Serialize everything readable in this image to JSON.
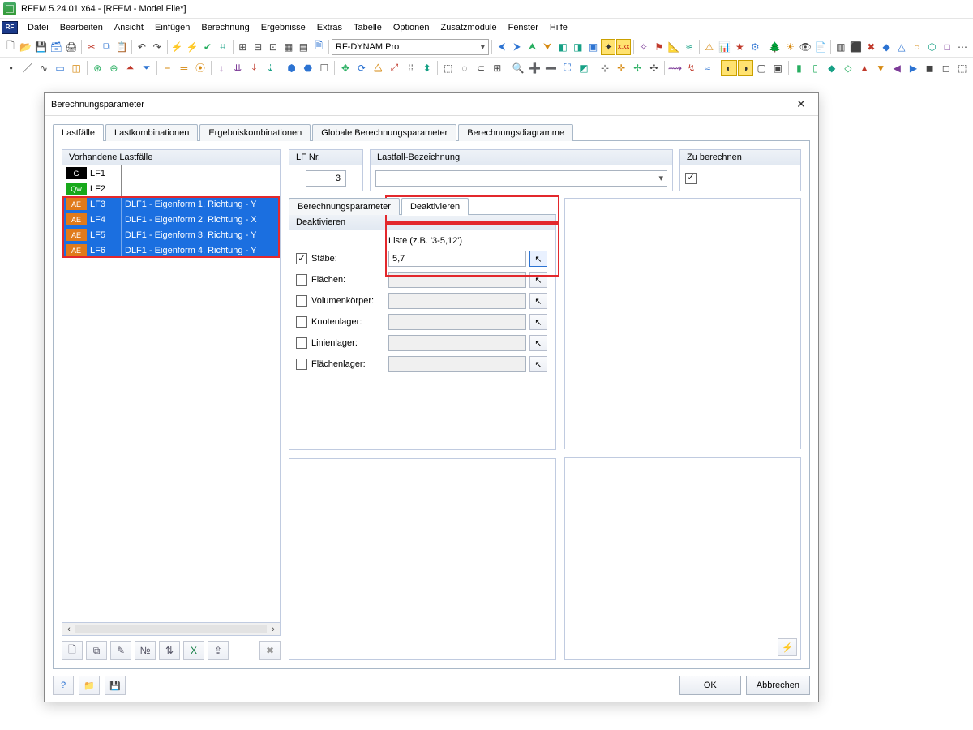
{
  "title": "RFEM 5.24.01 x64 - [RFEM - Model File*]",
  "mdi_icon": "RF",
  "menu": [
    "Datei",
    "Bearbeiten",
    "Ansicht",
    "Einfügen",
    "Berechnung",
    "Ergebnisse",
    "Extras",
    "Tabelle",
    "Optionen",
    "Zusatzmodule",
    "Fenster",
    "Hilfe"
  ],
  "toolbar_combo": "RF-DYNAM Pro",
  "dialog": {
    "title": "Berechnungsparameter",
    "tabs": [
      "Lastfälle",
      "Lastkombinationen",
      "Ergebniskombinationen",
      "Globale Berechnungsparameter",
      "Berechnungsdiagramme"
    ],
    "active_tab": 0,
    "left": {
      "caption": "Vorhandene Lastfälle",
      "rows": [
        {
          "tag": "G",
          "code": "LF1",
          "desc": "",
          "sel": false
        },
        {
          "tag": "Qw",
          "code": "LF2",
          "desc": "",
          "sel": false
        },
        {
          "tag": "AE",
          "code": "LF3",
          "desc": "DLF1 - Eigenform 1, Richtung - Y",
          "sel": true
        },
        {
          "tag": "AE",
          "code": "LF4",
          "desc": "DLF1 - Eigenform 2, Richtung - X",
          "sel": true
        },
        {
          "tag": "AE",
          "code": "LF5",
          "desc": "DLF1 - Eigenform 3, Richtung - Y",
          "sel": true
        },
        {
          "tag": "AE",
          "code": "LF6",
          "desc": "DLF1 - Eigenform 4, Richtung - Y",
          "sel": true
        }
      ]
    },
    "right": {
      "lfnr_caption": "LF Nr.",
      "lfnr_value": "3",
      "bez_caption": "Lastfall-Bezeichnung",
      "bez_value": "",
      "calc_caption": "Zu berechnen",
      "calc_checked": true,
      "sub_tabs": [
        "Berechnungsparameter",
        "Deaktivieren"
      ],
      "sub_active": 1,
      "deakt": {
        "caption": "Deaktivieren",
        "list_hdr": "Liste (z.B. '3-5,12')",
        "rows": [
          {
            "key": "staebe",
            "label": "Stäbe:",
            "checked": true,
            "value": "5,7",
            "hl": true
          },
          {
            "key": "flaechen",
            "label": "Flächen:",
            "checked": false,
            "value": ""
          },
          {
            "key": "volumen",
            "label": "Volumenkörper:",
            "checked": false,
            "value": ""
          },
          {
            "key": "knotenlager",
            "label": "Knotenlager:",
            "checked": false,
            "value": ""
          },
          {
            "key": "linienlager",
            "label": "Linienlager:",
            "checked": false,
            "value": ""
          },
          {
            "key": "flaechenlager",
            "label": "Flächenlager:",
            "checked": false,
            "value": ""
          }
        ]
      }
    },
    "buttons": {
      "ok": "OK",
      "cancel": "Abbrechen"
    }
  }
}
